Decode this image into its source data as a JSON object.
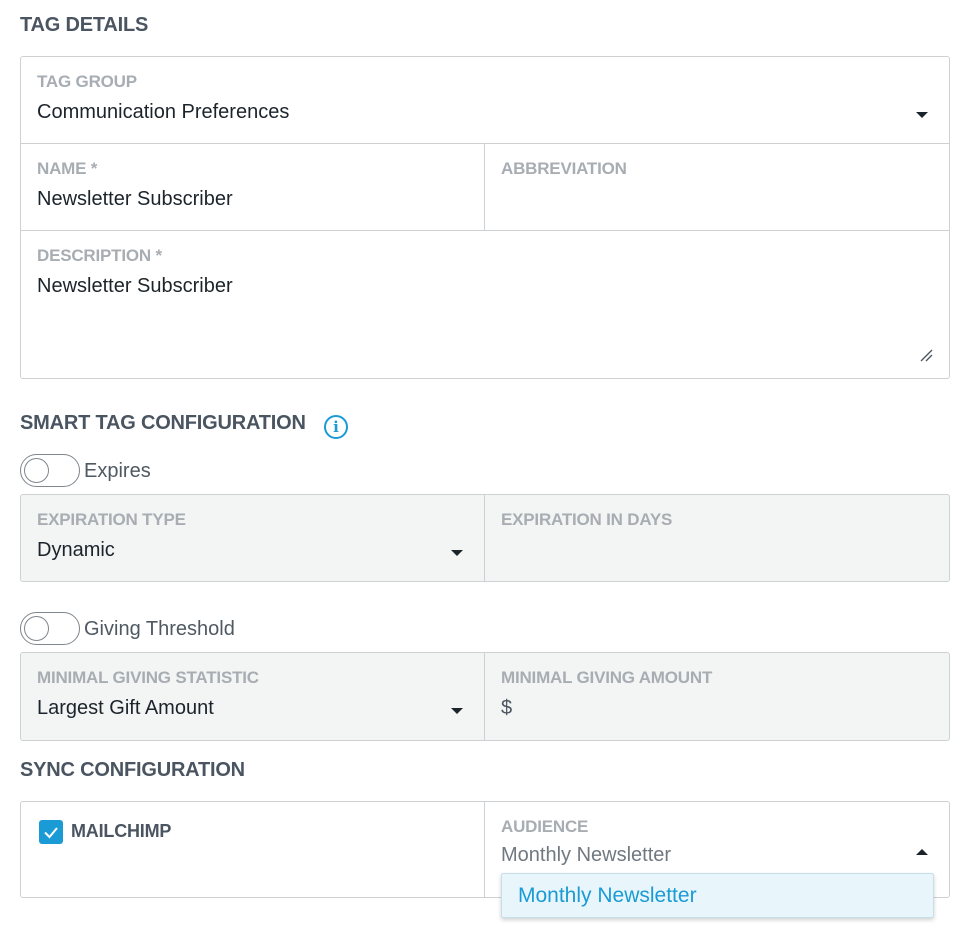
{
  "tag_details": {
    "title": "TAG DETAILS",
    "tag_group": {
      "label": "TAG GROUP",
      "value": "Communication Preferences"
    },
    "name": {
      "label": "NAME *",
      "value": "Newsletter Subscriber"
    },
    "abbreviation": {
      "label": "ABBREVIATION",
      "value": ""
    },
    "description": {
      "label": "DESCRIPTION *",
      "value": "Newsletter Subscriber"
    }
  },
  "smart_tag": {
    "title": "SMART TAG CONFIGURATION",
    "info_icon": "info-icon",
    "expires": {
      "toggle_label": "Expires",
      "enabled": false,
      "expiration_type": {
        "label": "EXPIRATION TYPE",
        "value": "Dynamic"
      },
      "expiration_days": {
        "label": "EXPIRATION IN DAYS",
        "value": ""
      }
    },
    "giving_threshold": {
      "toggle_label": "Giving Threshold",
      "enabled": false,
      "statistic": {
        "label": "MINIMAL GIVING STATISTIC",
        "value": "Largest Gift Amount"
      },
      "amount": {
        "label": "MINIMAL GIVING AMOUNT",
        "currency": "$",
        "value": ""
      }
    }
  },
  "sync": {
    "title": "SYNC CONFIGURATION",
    "mailchimp": {
      "label": "MAILCHIMP",
      "checked": true
    },
    "audience": {
      "label": "AUDIENCE",
      "value": "Monthly Newsletter",
      "options": [
        "Monthly Newsletter"
      ]
    }
  },
  "colors": {
    "accent": "#1a9bd6",
    "label_grey": "#a7adb2",
    "disabled_bg": "#f3f4f4",
    "dropdown_bg": "#e8f6fb"
  }
}
